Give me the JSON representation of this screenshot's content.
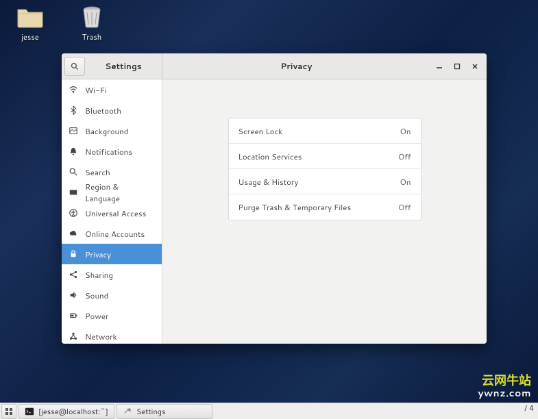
{
  "desktop": {
    "icons": [
      {
        "name": "jesse",
        "icon": "folder"
      },
      {
        "name": "Trash",
        "icon": "trash"
      }
    ]
  },
  "window": {
    "app_title": "Settings",
    "page_title": "Privacy",
    "controls": {
      "minimize": "—",
      "maximize": "▢",
      "close": "✕"
    }
  },
  "sidebar": {
    "items": [
      {
        "label": "Wi-Fi",
        "icon": "wifi",
        "selected": false
      },
      {
        "label": "Bluetooth",
        "icon": "bluetooth",
        "selected": false
      },
      {
        "label": "Background",
        "icon": "background",
        "selected": false
      },
      {
        "label": "Notifications",
        "icon": "bell",
        "selected": false
      },
      {
        "label": "Search",
        "icon": "search",
        "selected": false
      },
      {
        "label": "Region & Language",
        "icon": "region",
        "selected": false
      },
      {
        "label": "Universal Access",
        "icon": "accessibility",
        "selected": false
      },
      {
        "label": "Online Accounts",
        "icon": "cloud",
        "selected": false
      },
      {
        "label": "Privacy",
        "icon": "lock",
        "selected": true
      },
      {
        "label": "Sharing",
        "icon": "share",
        "selected": false
      },
      {
        "label": "Sound",
        "icon": "speaker",
        "selected": false
      },
      {
        "label": "Power",
        "icon": "power",
        "selected": false
      },
      {
        "label": "Network",
        "icon": "network",
        "selected": false
      }
    ]
  },
  "privacy": {
    "rows": [
      {
        "label": "Screen Lock",
        "value": "On"
      },
      {
        "label": "Location Services",
        "value": "Off"
      },
      {
        "label": "Usage & History",
        "value": "On"
      },
      {
        "label": "Purge Trash & Temporary Files",
        "value": "Off"
      }
    ]
  },
  "taskbar": {
    "items": [
      {
        "label": "[jesse@localhost:~]",
        "icon": "terminal"
      },
      {
        "label": "Settings",
        "icon": "settings"
      }
    ]
  },
  "watermark": {
    "line1": "云网牛站",
    "line2": "ywnz.com"
  },
  "page_counter": "/ 4"
}
